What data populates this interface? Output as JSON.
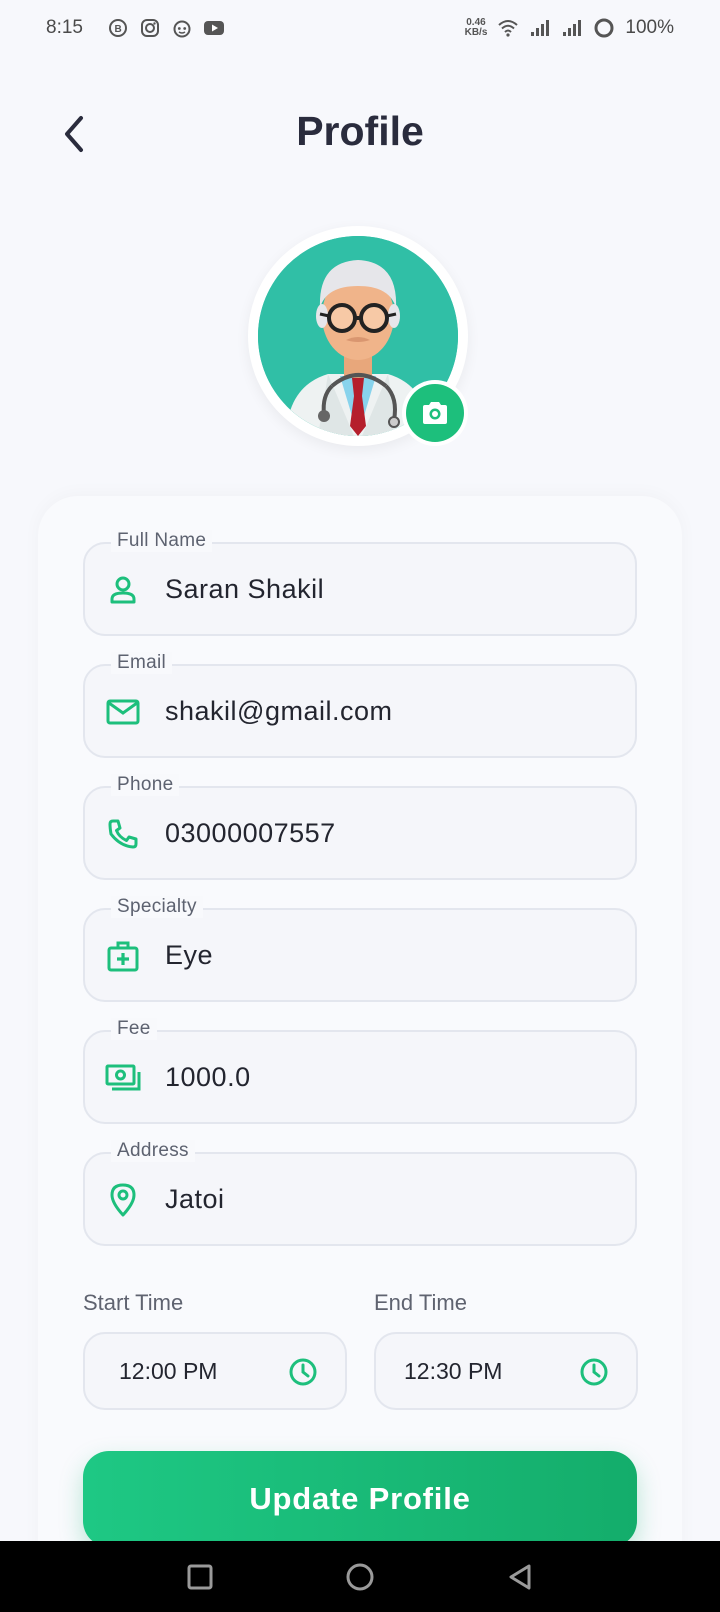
{
  "status_bar": {
    "time": "8:15",
    "net_speed_value": "0.46",
    "net_speed_unit": "KB/s",
    "battery": "100%",
    "icons": [
      "b-chat-icon",
      "instagram-icon",
      "reddit-icon",
      "youtube-icon",
      "wifi-icon",
      "signal-icon",
      "signal-icon",
      "battery-icon"
    ]
  },
  "header": {
    "title": "Profile",
    "back_icon": "chevron-left-icon"
  },
  "avatar": {
    "icon": "doctor-avatar",
    "camera_icon": "camera-icon"
  },
  "form": {
    "fields": [
      {
        "label": "Full Name",
        "value": "Saran Shakil",
        "icon": "person-icon"
      },
      {
        "label": "Email",
        "value": "shakil@gmail.com",
        "icon": "mail-icon"
      },
      {
        "label": "Phone",
        "value": "03000007557",
        "icon": "phone-icon"
      },
      {
        "label": "Specialty",
        "value": "Eye",
        "icon": "medical-bag-icon"
      },
      {
        "label": "Fee",
        "value": "1000.0",
        "icon": "money-icon"
      },
      {
        "label": "Address",
        "value": "Jatoi",
        "icon": "location-pin-icon"
      }
    ],
    "start_time": {
      "label": "Start Time",
      "value": "12:00 PM",
      "icon": "clock-icon"
    },
    "end_time": {
      "label": "End Time",
      "value": "12:30 PM",
      "icon": "clock-icon"
    },
    "submit_label": "Update Profile"
  },
  "colors": {
    "accent": "#1dbf7c",
    "avatar_bg": "#30bfa6",
    "title": "#2a2c3d",
    "background": "#f7f8fc"
  },
  "nav_bar": {
    "icons": [
      "recent-apps-icon",
      "home-icon",
      "back-icon"
    ]
  }
}
